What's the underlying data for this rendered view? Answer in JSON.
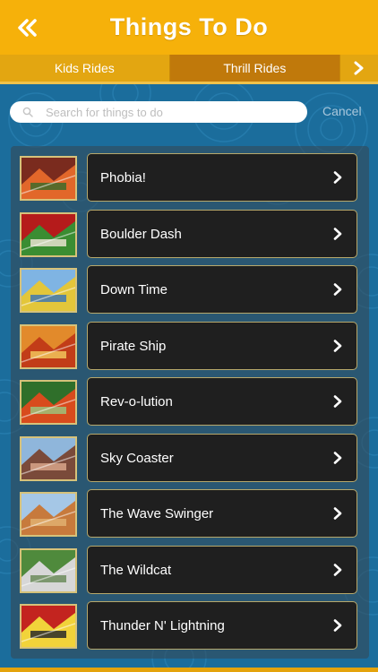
{
  "header": {
    "title": "Things To Do",
    "back_icon": "double-chevron-left-icon"
  },
  "tabs": [
    {
      "label": "Kids Rides",
      "active": false
    },
    {
      "label": "Thrill Rides",
      "active": true
    }
  ],
  "tab_next_icon": "chevron-right-icon",
  "search": {
    "placeholder": "Search for things to do",
    "value": "",
    "cancel_label": "Cancel"
  },
  "rides": [
    {
      "label": "Phobia!",
      "colors": [
        "#7a2b1e",
        "#e2672a",
        "#3e6b2a"
      ]
    },
    {
      "label": "Boulder Dash",
      "colors": [
        "#b51b1b",
        "#3a8d32",
        "#e8e2d0"
      ]
    },
    {
      "label": "Down Time",
      "colors": [
        "#7fb4e3",
        "#e3c63a",
        "#3f77b3"
      ]
    },
    {
      "label": "Pirate Ship",
      "colors": [
        "#e28a2b",
        "#c23d18",
        "#f1c35a"
      ]
    },
    {
      "label": "Rev-o-lution",
      "colors": [
        "#2f6f2a",
        "#d84b1d",
        "#9ec27b"
      ]
    },
    {
      "label": "Sky Coaster",
      "colors": [
        "#8fb6db",
        "#7a4a3a",
        "#d8a48a"
      ]
    },
    {
      "label": "The Wave Swinger",
      "colors": [
        "#a5c7e6",
        "#c77a3c",
        "#e0b070"
      ]
    },
    {
      "label": "The Wildcat",
      "colors": [
        "#4f8a3c",
        "#d7d7d7",
        "#6c8c5c"
      ]
    },
    {
      "label": "Thunder N' Lightning",
      "colors": [
        "#c3241f",
        "#f1d33a",
        "#2a2a2a"
      ]
    }
  ],
  "theme": {
    "header": "#f6b10a",
    "background": "#1b6d9c",
    "item": "#1f1f1f"
  }
}
